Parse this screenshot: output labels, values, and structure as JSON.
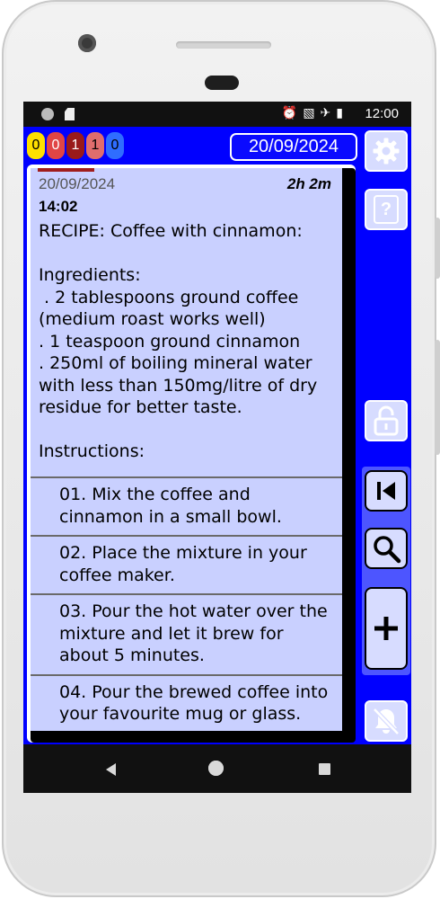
{
  "status_bar": {
    "time": "12:00",
    "icons": [
      "alarm-icon",
      "no-sim-icon",
      "airplane-icon",
      "battery-icon"
    ]
  },
  "counters": [
    {
      "value": "0",
      "bg": "#ffe000",
      "fg": "#000000"
    },
    {
      "value": "0",
      "bg": "#e04545",
      "fg": "#ffffff"
    },
    {
      "value": "1",
      "bg": "#9a1a1a",
      "fg": "#ffffff"
    },
    {
      "value": "1",
      "bg": "#e06d6d",
      "fg": "#000000"
    },
    {
      "value": "0",
      "bg": "#2f6dff",
      "fg": "#000000"
    }
  ],
  "header": {
    "date": "20/09/2024"
  },
  "note": {
    "date": "20/09/2024",
    "duration": "2h 2m",
    "time": "14:02",
    "body": "RECIPE: Coffee with cinnamon:\n\nIngredients:\n . 2 tablespoons ground coffee (medium roast works well)\n. 1 teaspoon ground cinnamon\n. 250ml of boiling mineral water with less than 150mg/litre of dry residue for better taste.\n\nInstructions:",
    "steps": [
      "01. Mix the coffee and cinnamon in a small bowl.",
      "02. Place the mixture in your coffee maker.",
      "03. Pour the hot water over the mixture and let it brew for about 5 minutes.",
      "04. Pour the brewed coffee into your favourite mug or glass."
    ]
  },
  "side_buttons": {
    "help_label": "?"
  },
  "colors": {
    "app_background": "#0000ff",
    "note_background": "#c9d0ff",
    "button_background": "#d7dcff"
  }
}
